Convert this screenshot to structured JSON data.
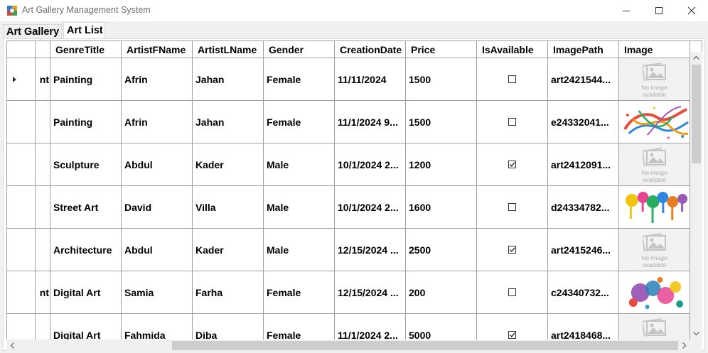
{
  "window": {
    "title": "Art Gallery Management System"
  },
  "tabs": [
    {
      "label": "Art Gallery"
    },
    {
      "label": "Art List"
    }
  ],
  "grid": {
    "columns": [
      "GenreTitle",
      "ArtistFName",
      "ArtistLName",
      "Gender",
      "CreationDate",
      "Price",
      "IsAvailable",
      "ImagePath",
      "Image"
    ],
    "rows": [
      {
        "prefix": "nt",
        "current": true,
        "genre": "Painting",
        "fname": "Afrin",
        "lname": "Jahan",
        "gender": "Female",
        "date": "11/11/2024",
        "price": "1500",
        "available": false,
        "path": "art2421544...",
        "image": "none"
      },
      {
        "prefix": "",
        "current": false,
        "genre": "Painting",
        "fname": "Afrin",
        "lname": "Jahan",
        "gender": "Female",
        "date": "11/1/2024 9...",
        "price": "1500",
        "available": false,
        "path": "e24332041...",
        "image": "splash-swirl"
      },
      {
        "prefix": "",
        "current": false,
        "genre": "Sculpture",
        "fname": "Abdul",
        "lname": "Kader",
        "gender": "Male",
        "date": "10/1/2024 2...",
        "price": "1200",
        "available": true,
        "path": "art2412091...",
        "image": "none"
      },
      {
        "prefix": "",
        "current": false,
        "genre": "Street Art",
        "fname": "David",
        "lname": "Villa",
        "gender": "Male",
        "date": "10/1/2024 2...",
        "price": "1600",
        "available": false,
        "path": "d24334782...",
        "image": "paint-drips"
      },
      {
        "prefix": "",
        "current": false,
        "genre": "Architecture",
        "fname": "Abdul",
        "lname": "Kader",
        "gender": "Male",
        "date": "12/15/2024 ...",
        "price": "2500",
        "available": true,
        "path": "art2415246...",
        "image": "none"
      },
      {
        "prefix": "nt",
        "current": false,
        "genre": "Digital Art",
        "fname": "Samia",
        "lname": "Farha",
        "gender": "Female",
        "date": "12/15/2024 ...",
        "price": "200",
        "available": false,
        "path": "c24340732...",
        "image": "digital-splash"
      },
      {
        "prefix": "",
        "current": false,
        "genre": "Digital Art",
        "fname": "Fahmida",
        "lname": "Diba",
        "gender": "Female",
        "date": "11/1/2024 2...",
        "price": "5000",
        "available": true,
        "path": "art2418468...",
        "image": "none"
      }
    ],
    "no_image_text": [
      "No image",
      "available"
    ]
  }
}
